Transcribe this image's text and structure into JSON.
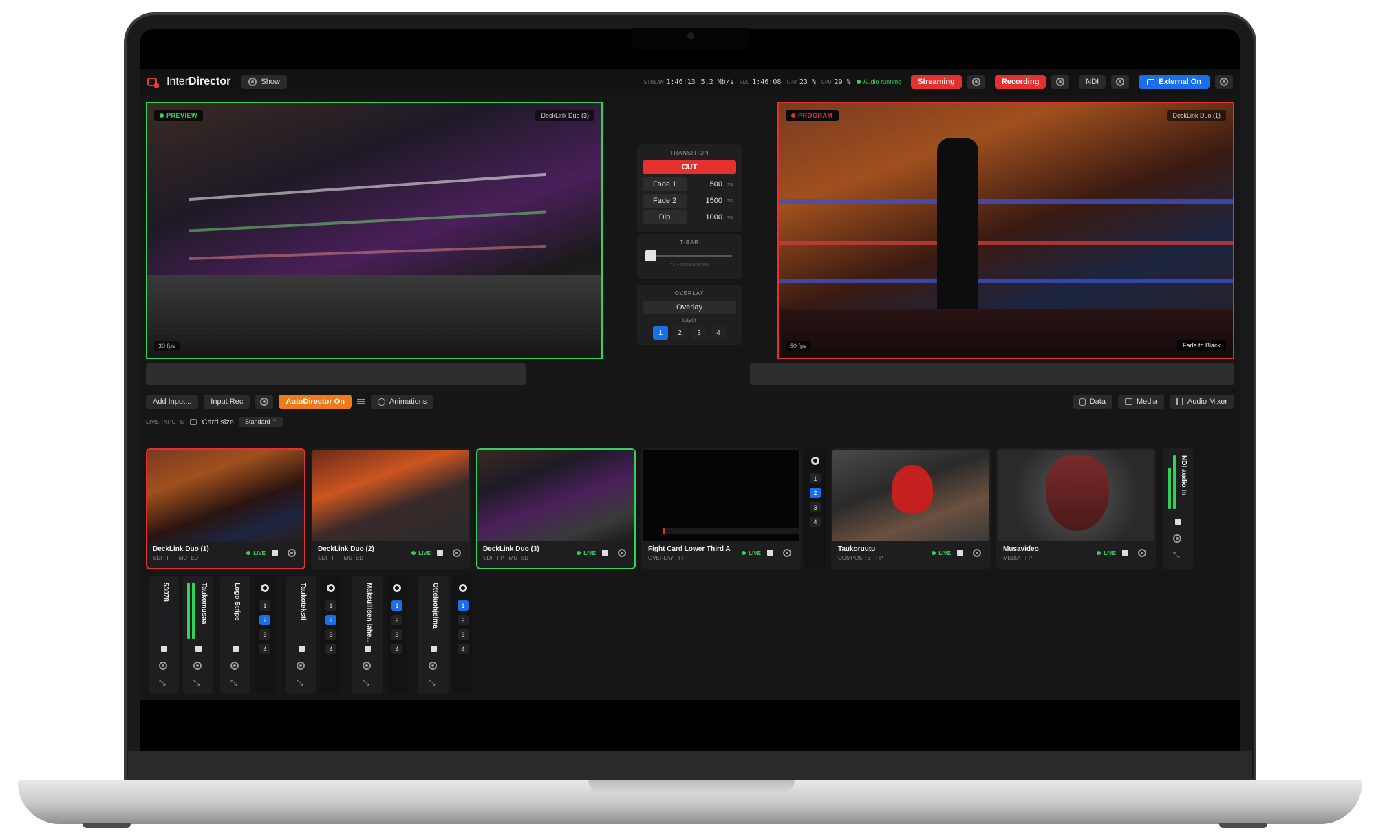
{
  "app": {
    "name_regular": "Inter",
    "name_bold": "Director",
    "show_label": "Show"
  },
  "stats": {
    "stream_key": "STREAM",
    "stream_time": "1:46:13",
    "bitrate": "5,2 Mb/s",
    "rec_key": "REC",
    "rec_time": "1:46:08",
    "cpu_key": "CPU",
    "cpu_value": "23 %",
    "gpu_key": "GPU",
    "gpu_value": "29 %",
    "audio_status": "Audio running"
  },
  "topbar": {
    "streaming": "Streaming",
    "recording": "Recording",
    "ndi": "NDI",
    "external": "External On"
  },
  "preview": {
    "label": "PREVIEW",
    "source": "DeckLink Duo (3)",
    "fps": "30 fps"
  },
  "program": {
    "label": "PROGRAM",
    "source": "DeckLink Duo (1)",
    "fps": "50 fps",
    "action": "Fade to Black"
  },
  "transition": {
    "title": "TRANSITION",
    "cut": "CUT",
    "rows": [
      {
        "name": "Fade 1",
        "value": "500",
        "unit": "ms"
      },
      {
        "name": "Fade 2",
        "value": "1500",
        "unit": "ms"
      },
      {
        "name": "Dip",
        "value": "1000",
        "unit": "ms"
      }
    ]
  },
  "tbar": {
    "title": "T-BAR",
    "hint": "⌥ + mouse wheel",
    "position": 0
  },
  "overlay": {
    "title": "OVERLAY",
    "button": "Overlay",
    "layer_label": "Layer",
    "layers": [
      "1",
      "2",
      "3",
      "4"
    ],
    "active_layer": "1"
  },
  "toolbar": {
    "add_input": "Add Input...",
    "input_rec": "Input Rec",
    "autodirector": "AutoDirector On",
    "animations": "Animations",
    "data": "Data",
    "media": "Media",
    "audio_mixer": "Audio Mixer"
  },
  "inputs_bar": {
    "label": "LIVE INPUTS",
    "card_size_label": "Card size",
    "card_size_value": "Standard"
  },
  "cards": [
    {
      "name": "DeckLink Duo (1)",
      "sub": "SDI · FP · MUTED",
      "live": "LIVE"
    },
    {
      "name": "DeckLink Duo (2)",
      "sub": "SDI · FP · MUTED",
      "live": "LIVE"
    },
    {
      "name": "DeckLink Duo (3)",
      "sub": "SDI · FP · MUTED",
      "live": "LIVE"
    },
    {
      "name": "Fight Card Lower Third A",
      "sub": "OVERLAY · FP",
      "live": "LIVE"
    },
    {
      "name": "Taukoruutu",
      "sub": "COMPOSITE · FP",
      "live": "LIVE"
    },
    {
      "name": "Musavideo",
      "sub": "MEDIA · FP",
      "live": "LIVE"
    }
  ],
  "card_layers": [
    "1",
    "2",
    "3",
    "4"
  ],
  "ndi_audio": "NDI audio in",
  "vcards": [
    {
      "title": "53078"
    },
    {
      "title": "Taukomusaa"
    },
    {
      "title": "Logo Stripe"
    },
    {
      "title": "Taukoteksti"
    },
    {
      "title": "Maksullisen lähe..."
    },
    {
      "title": "Otteluohjelma"
    }
  ],
  "colors": {
    "live": "#2fd35a",
    "program": "#e4302f",
    "accent_blue": "#1a6fe8",
    "accent_orange": "#f07a1a"
  }
}
